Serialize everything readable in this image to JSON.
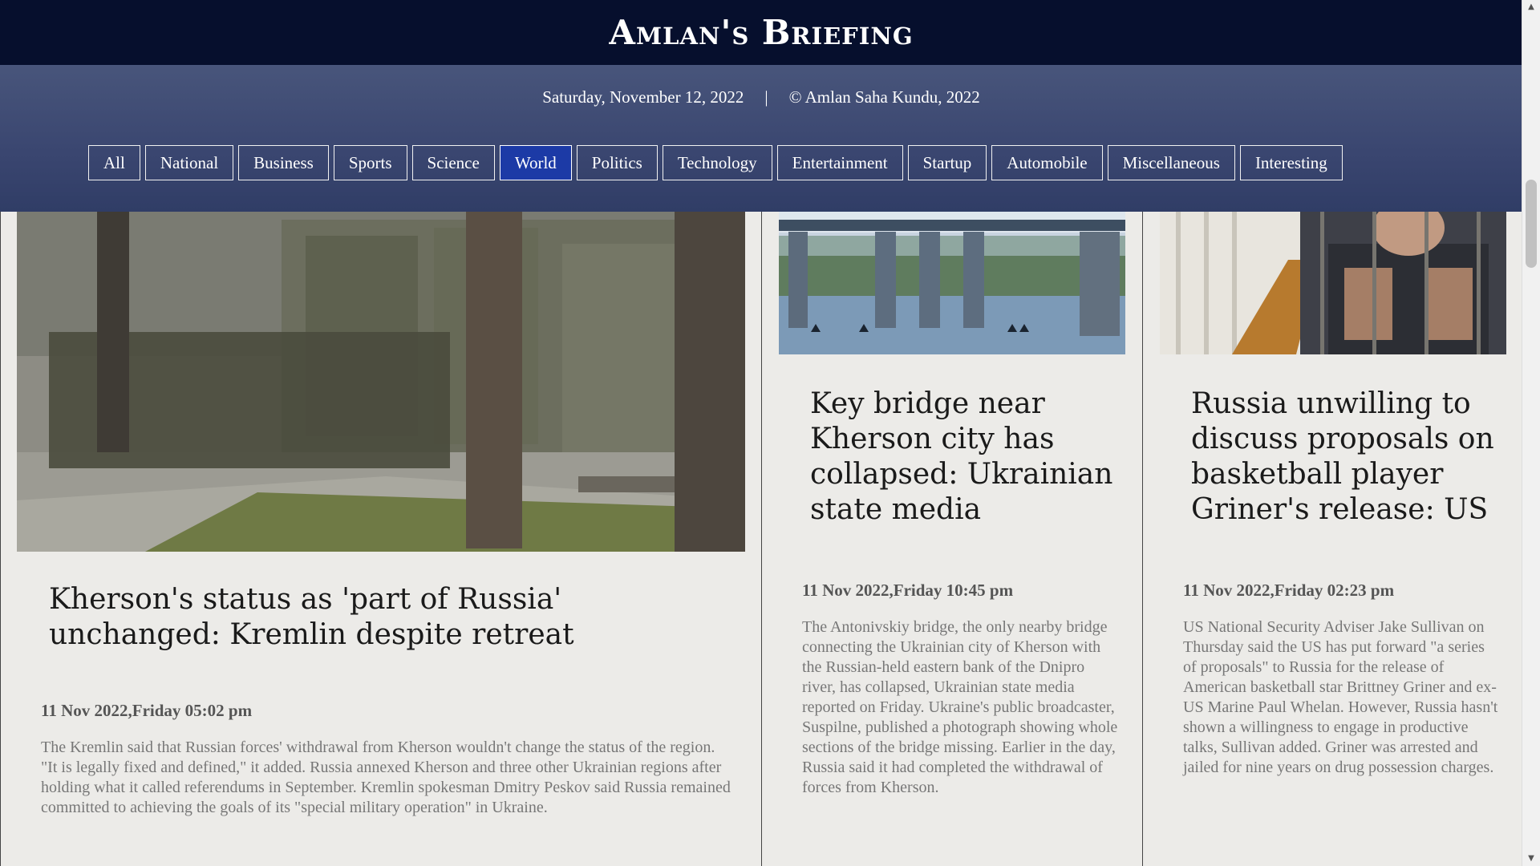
{
  "site": {
    "brand": "Amlan's Briefing",
    "date": "Saturday, November 12, 2022",
    "separator": "|",
    "copyright": "© Amlan Saha Kundu, 2022"
  },
  "nav": {
    "items": [
      "All",
      "National",
      "Business",
      "Sports",
      "Science",
      "World",
      "Politics",
      "Technology",
      "Entertainment",
      "Startup",
      "Automobile",
      "Miscellaneous",
      "Interesting"
    ],
    "active": "World"
  },
  "articles": [
    {
      "title": "Kherson's status as 'part of Russia' unchanged: Kremlin despite retreat",
      "datetime": "11 Nov 2022,Friday  05:02 pm",
      "summary": "The Kremlin said that Russian forces' withdrawal from Kherson wouldn't change the status of the region. \"It is legally fixed and defined,\" it added. Russia annexed Kherson and three other Ukrainian regions after holding what it called referendums in September. Kremlin spokesman Dmitry Peskov said Russia remained committed to achieving the goals of its \"special military operation\" in Ukraine."
    },
    {
      "title": "Key bridge near Kherson city has collapsed: Ukrainian state media",
      "datetime": "11 Nov 2022,Friday  10:45 pm",
      "summary": "The Antonivskiy bridge, the only nearby bridge connecting the Ukrainian city of Kherson with the Russian-held eastern bank of the Dnipro river, has collapsed, Ukrainian state media reported on Friday. Ukraine's public broadcaster, Suspilne, published a photograph showing whole sections of the bridge missing. Earlier in the day, Russia said it had completed the withdrawal of forces from Kherson."
    },
    {
      "title": "Russia unwilling to discuss proposals on basketball player Griner's release: US",
      "datetime": "11 Nov 2022,Friday  02:23 pm",
      "summary": "US National Security Adviser Jake Sullivan on Thursday said the US has put forward \"a series of proposals\" to Russia for the release of American basketball star Brittney Griner and ex-US Marine Paul Whelan. However, Russia hasn't shown a willingness to engage in productive talks, Sullivan added. Griner was arrested and jailed for nine years on drug possession charges."
    }
  ],
  "colors": {
    "header_bg": "#060f2d",
    "subbar_bg": "#3a4670",
    "active_tab": "#1c3aa6",
    "page_bg": "#ecebe8"
  }
}
